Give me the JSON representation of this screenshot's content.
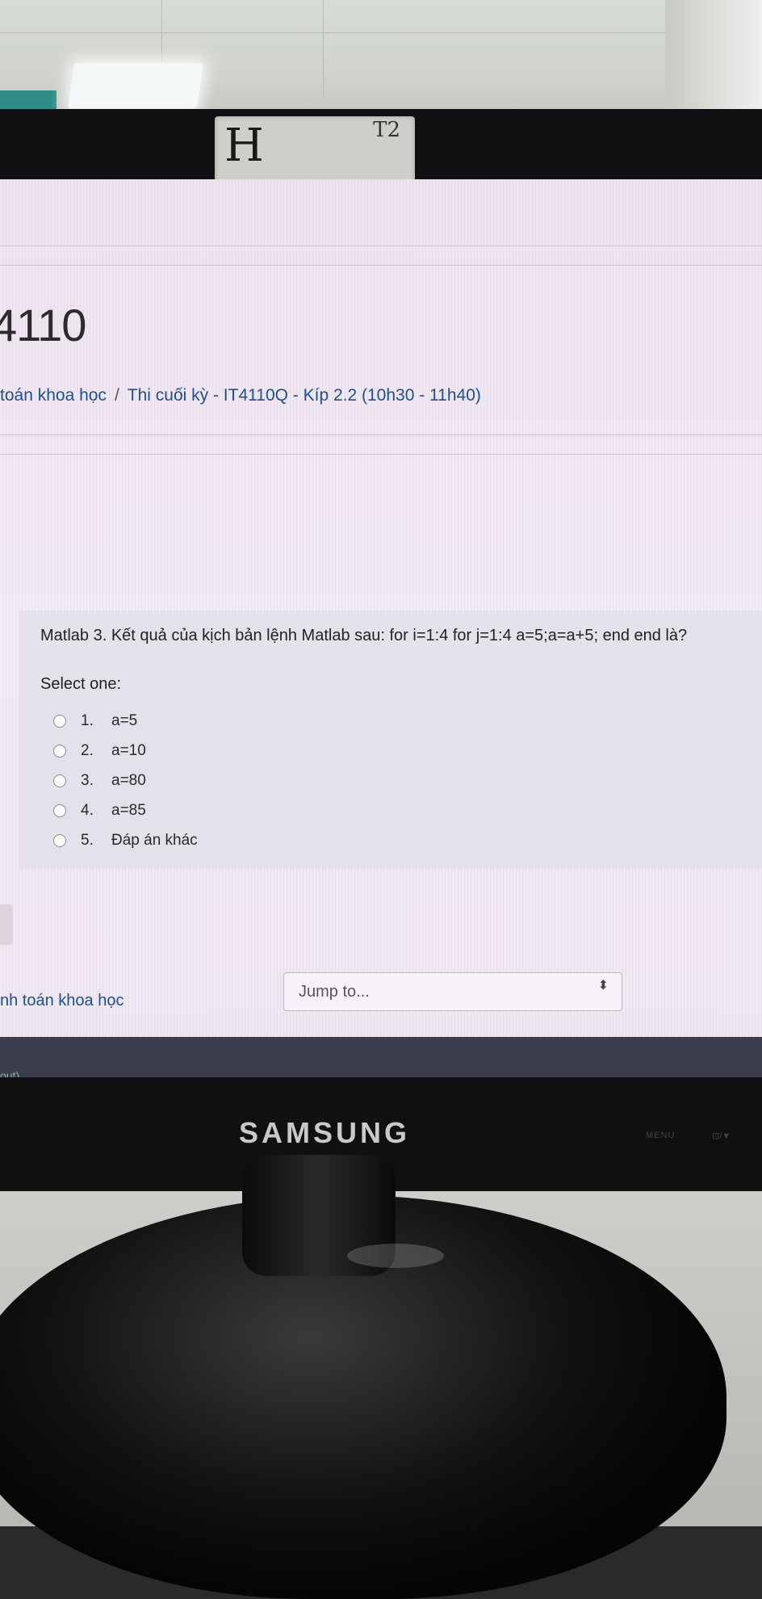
{
  "device": {
    "brand": "SAMSUNG",
    "menu_label": "MENU",
    "ctrl_label": "⊡/▼",
    "tape_letter": "H",
    "tape_mark": "T2"
  },
  "page": {
    "course_code": "4110",
    "breadcrumb": {
      "item1": "toán khoa học",
      "separator": "/",
      "item2": "Thi cuối kỳ - IT4110Q - Kíp 2.2 (10h30 - 11h40)"
    }
  },
  "question": {
    "text": "Matlab 3. Kết quả của kịch bản lệnh Matlab sau: for i=1:4 for j=1:4 a=5;a=a+5; end end là?",
    "select_label": "Select one:",
    "options": [
      {
        "num": "1.",
        "label": "a=5"
      },
      {
        "num": "2.",
        "label": "a=10"
      },
      {
        "num": "3.",
        "label": "a=80"
      },
      {
        "num": "4.",
        "label": "a=85"
      },
      {
        "num": "5.",
        "label": "Đáp án khác"
      }
    ]
  },
  "footer": {
    "course_link": "nh toán khoa học",
    "jump_placeholder": "Jump to...",
    "jump_arrow": "⬍",
    "logout_fragment": "out)"
  }
}
